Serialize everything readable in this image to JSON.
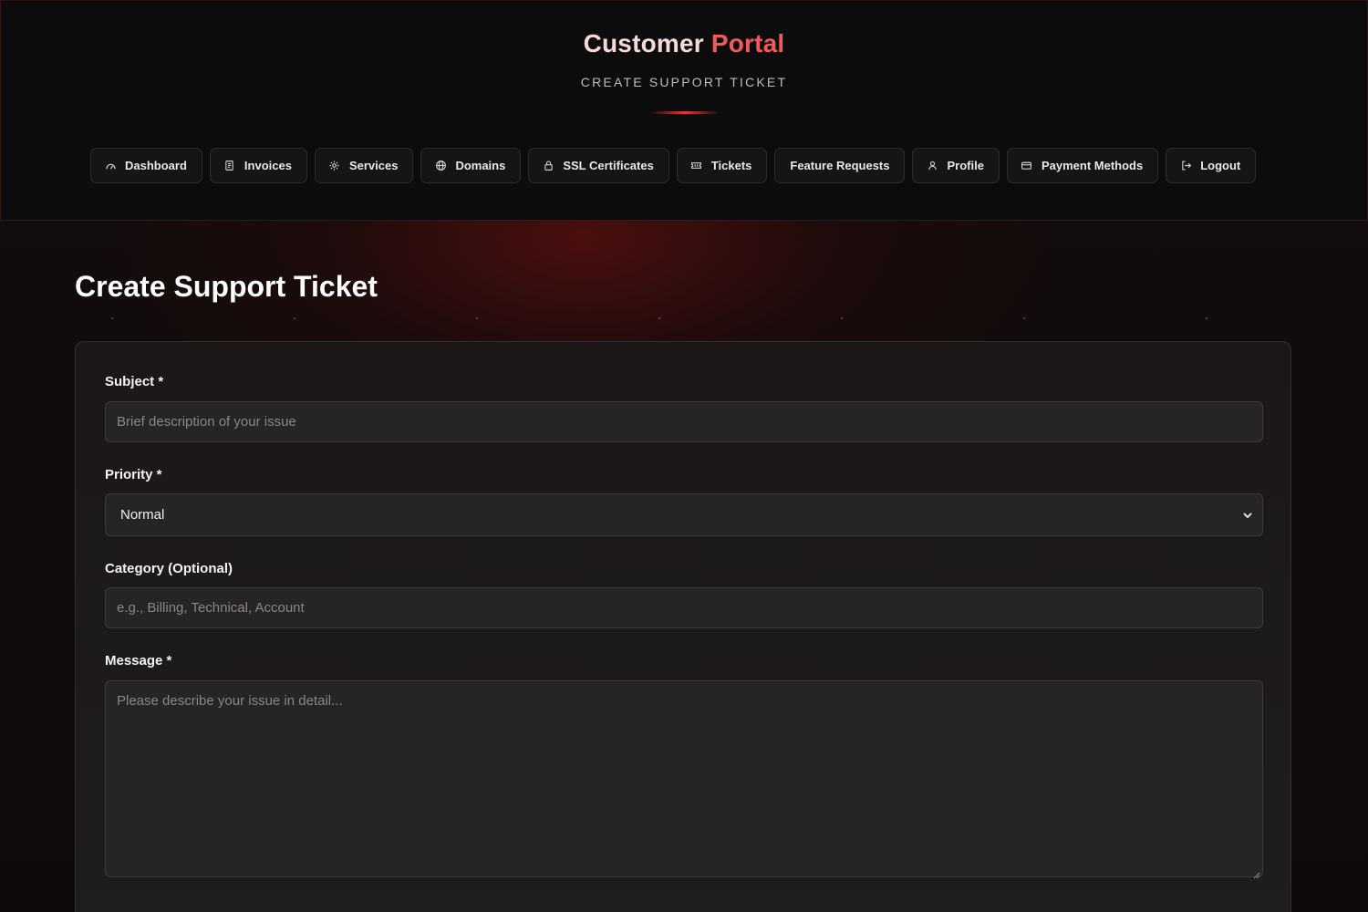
{
  "header": {
    "brand_part1": "Customer",
    "brand_part2": "Portal",
    "subtitle": "CREATE SUPPORT TICKET",
    "accent_color": "#e23b3b"
  },
  "nav": {
    "items": [
      {
        "label": "Dashboard",
        "icon": "gauge-icon"
      },
      {
        "label": "Invoices",
        "icon": "receipt-icon"
      },
      {
        "label": "Services",
        "icon": "gear-icon"
      },
      {
        "label": "Domains",
        "icon": "globe-icon"
      },
      {
        "label": "SSL Certificates",
        "icon": "lock-icon"
      },
      {
        "label": "Tickets",
        "icon": "ticket-icon"
      },
      {
        "label": "Feature Requests",
        "icon": ""
      },
      {
        "label": "Profile",
        "icon": "user-icon"
      },
      {
        "label": "Payment Methods",
        "icon": "credit-card-icon"
      },
      {
        "label": "Logout",
        "icon": "logout-icon"
      }
    ]
  },
  "main": {
    "title": "Create Support Ticket"
  },
  "form": {
    "subject_label": "Subject *",
    "subject_placeholder": "Brief description of your issue",
    "subject_value": "",
    "priority_label": "Priority *",
    "priority_value": "Normal",
    "category_label": "Category (Optional)",
    "category_placeholder": "e.g., Billing, Technical, Account",
    "category_value": "",
    "message_label": "Message *",
    "message_placeholder": "Please describe your issue in detail...",
    "message_value": ""
  }
}
